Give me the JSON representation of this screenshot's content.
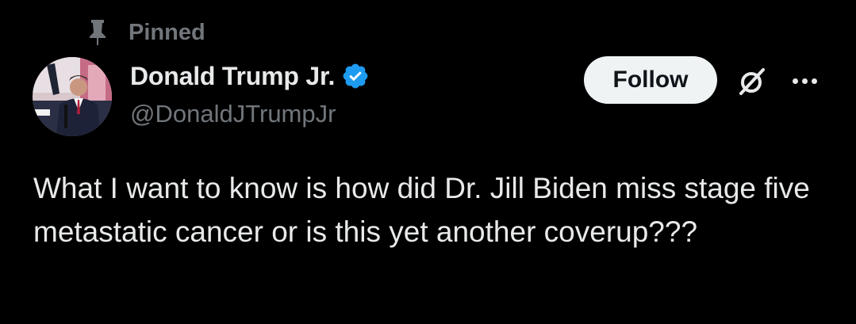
{
  "pinned": {
    "label": "Pinned",
    "icon": "pin-icon"
  },
  "author": {
    "name": "Donald Trump Jr.",
    "handle": "@DonaldJTrumpJr",
    "verified": true,
    "verified_color": "#1d9bf0",
    "avatar_icon": "avatar"
  },
  "actions": {
    "follow_label": "Follow",
    "grok_icon": "grok-icon",
    "more_icon": "more-icon"
  },
  "tweet": {
    "text": "What I want to know is how did Dr. Jill Biden miss stage five metastatic cancer or is this yet another coverup???"
  },
  "colors": {
    "background": "#000000",
    "text_primary": "#e7e9ea",
    "text_secondary": "#71767b",
    "button_bg": "#eff3f4"
  }
}
